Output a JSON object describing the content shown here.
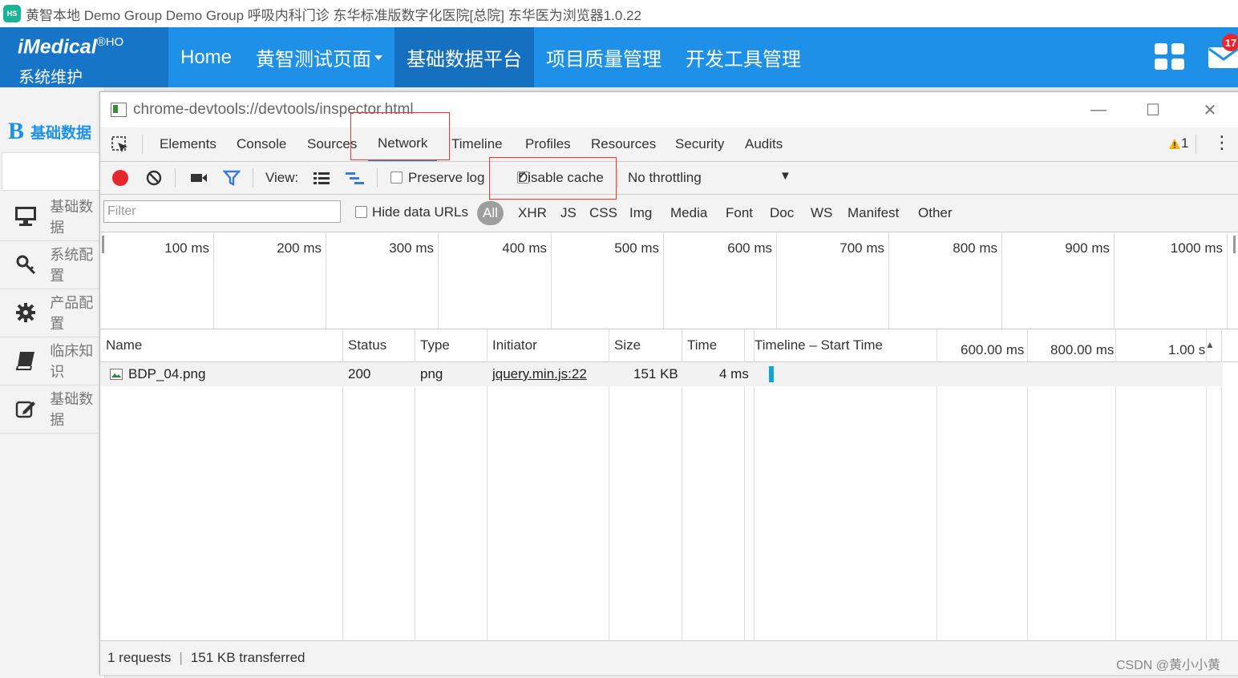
{
  "app": {
    "title": "黄智本地 Demo Group Demo Group 呼吸内科门诊 东华标准版数字化医院[总院]  东华医为浏览器1.0.22",
    "logo_text": "HS",
    "brand_logo": "iMedical",
    "brand_mark": "®HO",
    "brand_sub": "系统维护",
    "nav": [
      "Home",
      "黄智测试页面",
      "基础数据平台",
      "项目质量管理",
      "开发工具管理"
    ],
    "active_nav": "基础数据平台",
    "mail_badge": "17",
    "left_header_letter": "B",
    "left_header": "基础数据",
    "left_items": [
      {
        "label": "基础数据",
        "icon": "monitor-icon"
      },
      {
        "label": "系统配置",
        "icon": "key-icon"
      },
      {
        "label": "产品配置",
        "icon": "gear-icon"
      },
      {
        "label": "临床知识",
        "icon": "book-icon"
      },
      {
        "label": "基础数据",
        "icon": "edit-icon"
      }
    ]
  },
  "devtools": {
    "title": "chrome-devtools://devtools/inspector.html",
    "tabs": [
      "Elements",
      "Console",
      "Sources",
      "Network",
      "Timeline",
      "Profiles",
      "Resources",
      "Security",
      "Audits"
    ],
    "active_tab": "Network",
    "warning_count": "1",
    "toolbar": {
      "view_label": "View:",
      "preserve_log": "Preserve log",
      "disable_cache": "Disable cache",
      "throttling": "No throttling"
    },
    "filter": {
      "placeholder": "Filter",
      "hide_data_urls": "Hide data URLs",
      "types": [
        "All",
        "XHR",
        "JS",
        "CSS",
        "Img",
        "Media",
        "Font",
        "Doc",
        "WS",
        "Manifest",
        "Other"
      ]
    },
    "overview_ticks": [
      "100 ms",
      "200 ms",
      "300 ms",
      "400 ms",
      "500 ms",
      "600 ms",
      "700 ms",
      "800 ms",
      "900 ms",
      "1000 ms"
    ],
    "columns": [
      "Name",
      "Status",
      "Type",
      "Initiator",
      "Size",
      "Time",
      "Timeline – Start Time"
    ],
    "timeline_ticks": [
      "600.00 ms",
      "800.00 ms",
      "1.00 s"
    ],
    "rows": [
      {
        "name": "BDP_04.png",
        "status": "200",
        "type": "png",
        "initiator": "jquery.min.js:22",
        "size": "151 KB",
        "time": "4 ms"
      }
    ],
    "status_bar": {
      "requests": "1 requests",
      "transferred": "151 KB transferred"
    }
  },
  "watermark": "CSDN @黄小小黄",
  "colors": {
    "accent": "#1e90e8",
    "highlight": "#e33333",
    "record": "#e8262e"
  }
}
